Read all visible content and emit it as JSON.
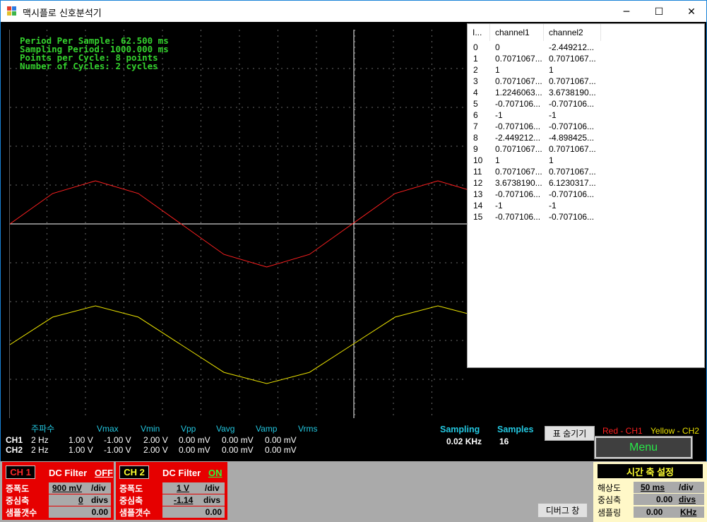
{
  "window": {
    "title": "맥시플로 신호분석기",
    "minimize_glyph": "─",
    "maximize_glyph": "☐",
    "close_glyph": "✕"
  },
  "scope": {
    "info": [
      "Period Per Sample: 62.500 ms",
      "Sampling Period: 1000.000 ms",
      "Points per Cycle: 8 points",
      "Number of Cycles: 2 cycles"
    ],
    "colors": {
      "ch1": "#ff2020",
      "ch2": "#e8e000",
      "grid": "#6a6a6a",
      "axis": "#ffffff"
    }
  },
  "table": {
    "headers": [
      "I...",
      "channel1",
      "channel2"
    ],
    "rows": [
      [
        "0",
        "0",
        "-2.449212..."
      ],
      [
        "1",
        "0.7071067...",
        "0.7071067..."
      ],
      [
        "2",
        "1",
        "1"
      ],
      [
        "3",
        "0.7071067...",
        "0.7071067..."
      ],
      [
        "4",
        "1.2246063...",
        "3.6738190..."
      ],
      [
        "5",
        "-0.707106...",
        "-0.707106..."
      ],
      [
        "6",
        "-1",
        "-1"
      ],
      [
        "7",
        "-0.707106...",
        "-0.707106..."
      ],
      [
        "8",
        "-2.449212...",
        "-4.898425..."
      ],
      [
        "9",
        "0.7071067...",
        "0.7071067..."
      ],
      [
        "10",
        "1",
        "1"
      ],
      [
        "11",
        "0.7071067...",
        "0.7071067..."
      ],
      [
        "12",
        "3.6738190...",
        "6.1230317..."
      ],
      [
        "13",
        "-0.707106...",
        "-0.707106..."
      ],
      [
        "14",
        "-1",
        "-1"
      ],
      [
        "15",
        "-0.707106...",
        "-0.707106..."
      ]
    ]
  },
  "measurements": {
    "headers": [
      "주파수",
      "Vmax",
      "Vmin",
      "Vpp",
      "Vavg",
      "Vamp",
      "Vrms"
    ],
    "ch1": {
      "label": "CH1",
      "values": [
        "2 Hz",
        "1.00 V",
        "-1.00 V",
        "2.00 V",
        "0.00 mV",
        "0.00 mV",
        "0.00 mV"
      ]
    },
    "ch2": {
      "label": "CH2",
      "values": [
        "2 Hz",
        "1.00 V",
        "-1.00 V",
        "2.00 V",
        "0.00 mV",
        "0.00 mV",
        "0.00 mV"
      ]
    }
  },
  "sampling": {
    "label": "Sampling",
    "value": "0.02 KHz"
  },
  "samples": {
    "label": "Samples",
    "value": "16"
  },
  "buttons": {
    "hide_table": "표 숨기기",
    "menu": "Menu",
    "debug": "디버그 창"
  },
  "legend": {
    "ch1": "Red - CH1",
    "ch2": "Yellow - CH2"
  },
  "ch1_panel": {
    "title": "CH 1",
    "dc_filter_label": "DC Filter",
    "dc_filter_state": "OFF",
    "rows": [
      {
        "label": "증폭도",
        "value": "900 mV",
        "unit": "/div"
      },
      {
        "label": "중심축",
        "value": "0",
        "unit": "divs"
      },
      {
        "label": "샘플갯수",
        "value": "0.00",
        "unit": ""
      }
    ]
  },
  "ch2_panel": {
    "title": "CH 2",
    "dc_filter_label": "DC Filter",
    "dc_filter_state": "ON",
    "rows": [
      {
        "label": "증폭도",
        "value": "1 V",
        "unit": "/div"
      },
      {
        "label": "중심축",
        "value": "-1.14",
        "unit": "divs"
      },
      {
        "label": "샘플갯수",
        "value": "0.00",
        "unit": ""
      }
    ]
  },
  "time_panel": {
    "title": "시간 축 설정",
    "rows": [
      {
        "label": "해상도",
        "value": "50 ms",
        "unit": "/div"
      },
      {
        "label": "중심축",
        "value": "0.00",
        "unit": "divs"
      },
      {
        "label": "샘플링",
        "value": "0.00",
        "unit": "KHz"
      }
    ]
  }
}
